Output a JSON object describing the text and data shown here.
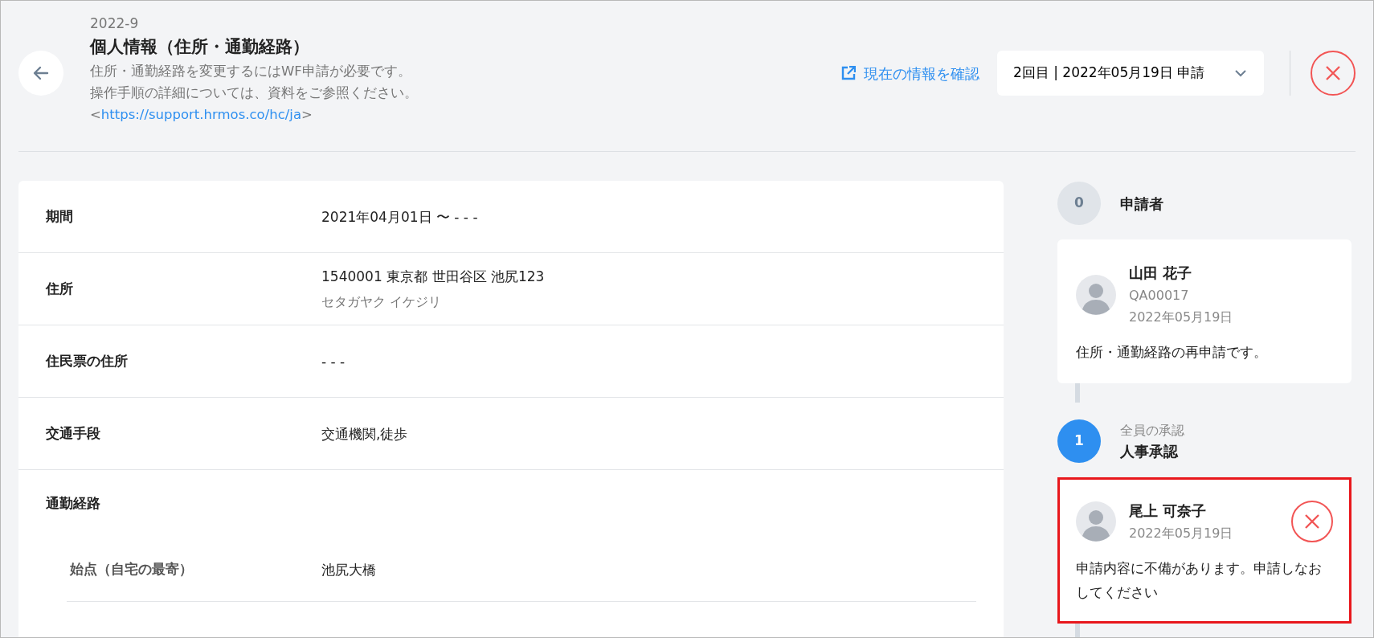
{
  "header": {
    "code": "2022-9",
    "title": "個人情報（住所・通勤経路）",
    "description": [
      "住所・通勤経路を変更するにはWF申請が必要です。",
      "操作手順の詳細については、資料をご参照ください。"
    ],
    "link_open": "<",
    "link": "https://support.hrmos.co/hc/ja",
    "link_close": ">",
    "check_current": "現在の情報を確認",
    "version_select": "2回目 | 2022年05月19日 申請"
  },
  "fields": [
    {
      "label": "期間",
      "values": [
        "2021年04月01日 〜 - - -"
      ]
    },
    {
      "label": "住所",
      "values": [
        "1540001 東京都 世田谷区 池尻123"
      ],
      "sub": "セタガヤク イケジリ"
    },
    {
      "label": "住民票の住所",
      "values": [
        "- - -"
      ]
    },
    {
      "label": "交通手段",
      "values": [
        "交通機関,徒歩"
      ]
    },
    {
      "label": "通勤経路",
      "children": [
        {
          "label": "始点（自宅の最寄）",
          "values": [
            "池尻大橋"
          ]
        }
      ]
    }
  ],
  "steps": [
    {
      "number": "0",
      "active": false,
      "title": "申請者",
      "card": {
        "name": "山田 花子",
        "lines": [
          "QA00017",
          "2022年05月19日"
        ],
        "comment": "住所・通勤経路の再申請です。",
        "rejected": false,
        "highlighted": false
      }
    },
    {
      "number": "1",
      "active": true,
      "subtitle": "全員の承認",
      "title": "人事承認",
      "card": {
        "name": "尾上 可奈子",
        "lines": [
          "2022年05月19日"
        ],
        "comment": "申請内容に不備があります。申請しなおしてください",
        "rejected": true,
        "highlighted": true
      }
    }
  ]
}
